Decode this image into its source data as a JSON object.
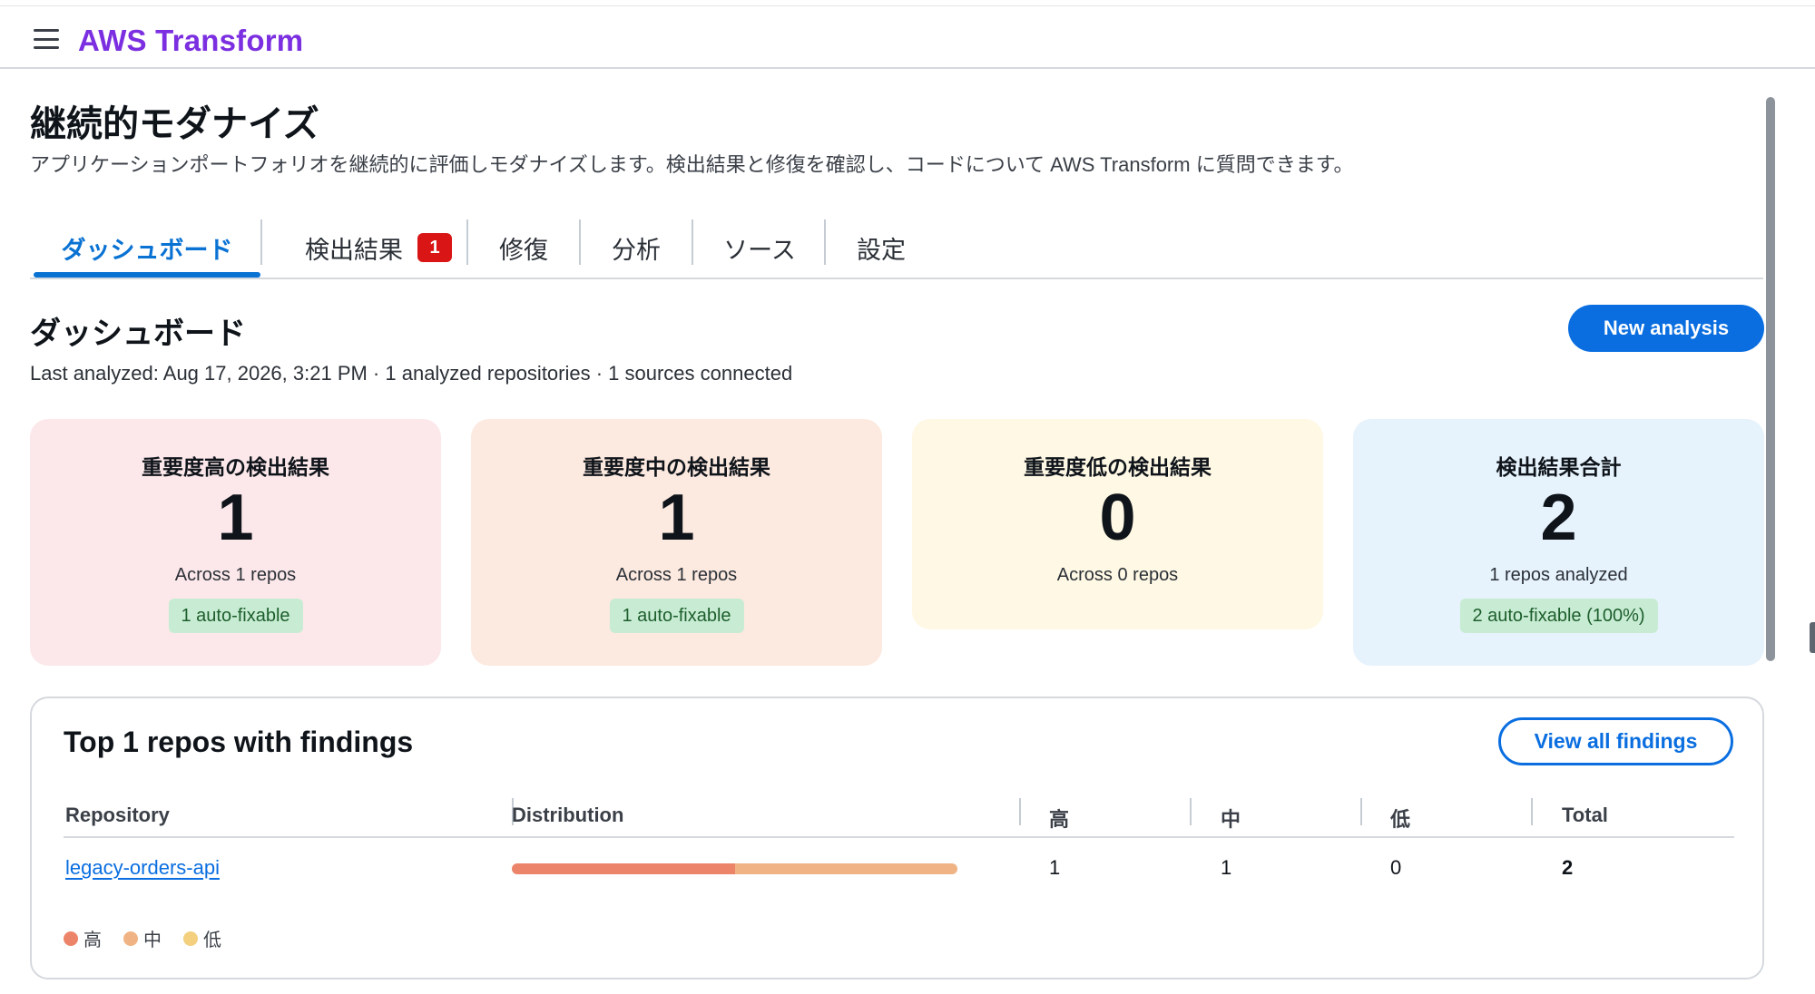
{
  "app": {
    "name": "AWS Transform"
  },
  "page": {
    "title": "継続的モダナイズ",
    "description": "アプリケーションポートフォリオを継続的に評価しモダナイズします。検出結果と修復を確認し、コードについて AWS Transform に質問できます。"
  },
  "tabs": [
    {
      "label": "ダッシュボード",
      "active": true
    },
    {
      "label": "検出結果",
      "badge": "1"
    },
    {
      "label": "修復"
    },
    {
      "label": "分析"
    },
    {
      "label": "ソース"
    },
    {
      "label": "設定"
    }
  ],
  "dashboard": {
    "title": "ダッシュボード",
    "new_analysis_label": "New analysis",
    "meta": "Last analyzed: Aug 17, 2026, 3:21 PM · 1 analyzed repositories · 1 sources connected"
  },
  "cards": [
    {
      "title": "重要度高の検出結果",
      "value": "1",
      "sub": "Across 1 repos",
      "pill": "1 auto-fixable",
      "bg": "#fce8ea"
    },
    {
      "title": "重要度中の検出結果",
      "value": "1",
      "sub": "Across 1 repos",
      "pill": "1 auto-fixable",
      "bg": "#fce9df"
    },
    {
      "title": "重要度低の検出結果",
      "value": "0",
      "sub": "Across 0 repos",
      "bg": "#fef8e4"
    },
    {
      "title": "検出結果合計",
      "value": "2",
      "sub": "1 repos analyzed",
      "pill": "2 auto-fixable (100%)",
      "bg": "#e6f2fc"
    }
  ],
  "top_repos": {
    "title": "Top 1 repos with findings",
    "view_all_label": "View all findings",
    "columns": [
      "Repository",
      "Distribution",
      "高",
      "中",
      "低",
      "Total"
    ],
    "rows": [
      {
        "repository": "legacy-orders-api",
        "high": "1",
        "medium": "1",
        "low": "0",
        "total": "2",
        "distribution": {
          "high": 0.5,
          "medium": 0.5,
          "low": 0
        }
      }
    ],
    "legend": [
      {
        "label": "高",
        "color": "#ec8469"
      },
      {
        "label": "中",
        "color": "#f0b484"
      },
      {
        "label": "低",
        "color": "#f3cf7e"
      }
    ]
  },
  "colors": {
    "brand": "#7b2fe0",
    "primary": "#0a6ee0",
    "badge": "#d91515",
    "pill_bg": "#c8ecd3",
    "high": "#ec8469",
    "medium": "#f0b484",
    "low": "#f3cf7e"
  }
}
